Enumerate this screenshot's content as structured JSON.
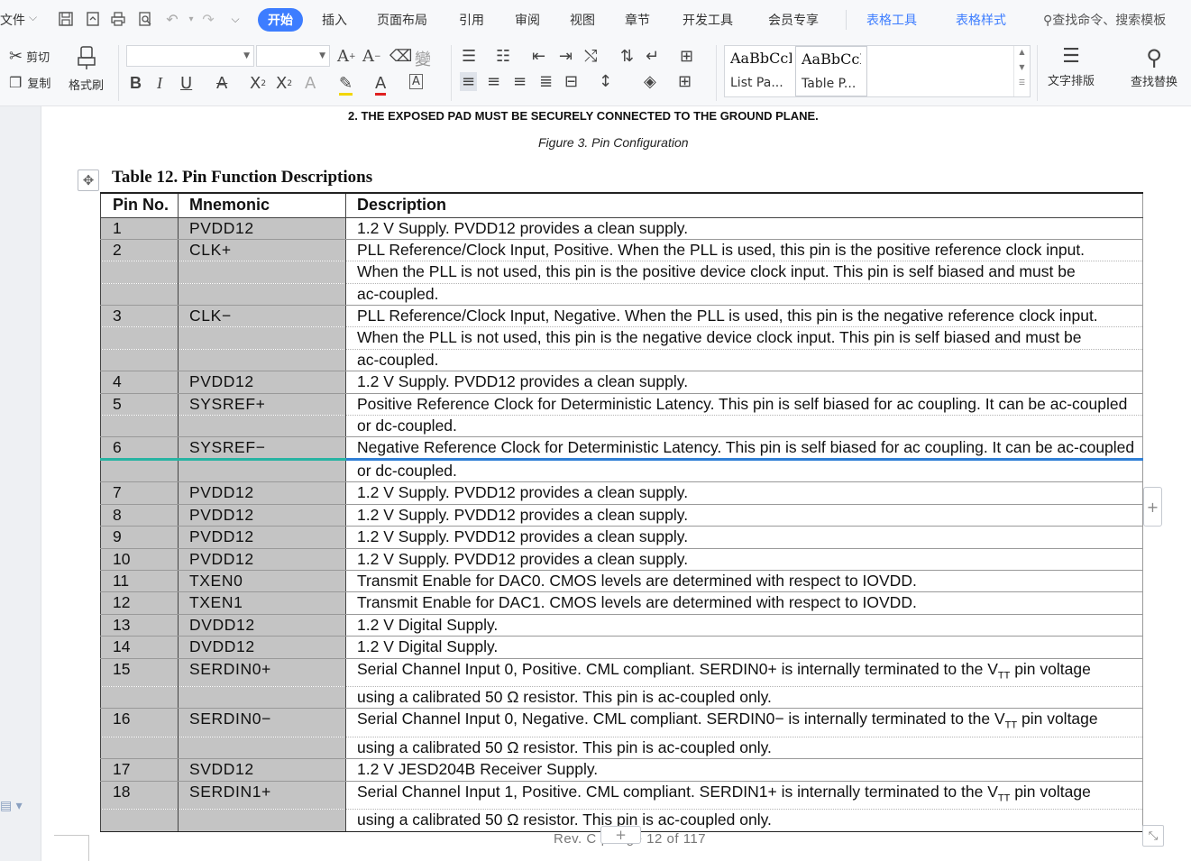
{
  "menubar": {
    "file_label": "文件",
    "tabs": [
      "开始",
      "插入",
      "页面布局",
      "引用",
      "审阅",
      "视图",
      "章节",
      "开发工具",
      "会员专享"
    ],
    "context_tabs": [
      "表格工具",
      "表格样式"
    ],
    "search_placeholder": "查找命令、搜索模板"
  },
  "ribbon": {
    "cut_label": "剪切",
    "copy_label": "复制",
    "format_painter_label": "格式刷",
    "styles": [
      {
        "sample": "AaBbCcI",
        "name": "List Pa..."
      },
      {
        "sample": "AaBbCcD",
        "name": "Table P..."
      }
    ],
    "text_layout_label": "文字排版",
    "find_replace_label": "查找替换"
  },
  "document": {
    "note": "2. THE EXPOSED PAD MUST BE SECURELY CONNECTED TO THE GROUND PLANE.",
    "figure_caption": "Figure 3. Pin Configuration",
    "table_title": "Table 12. Pin Function Descriptions",
    "headers": {
      "pin": "Pin No.",
      "mnemonic": "Mnemonic",
      "description": "Description"
    },
    "rows": [
      {
        "pin": "1",
        "mnemonic": "PVDD12",
        "lines": [
          "1.2 V Supply. PVDD12 provides a clean supply."
        ]
      },
      {
        "pin": "2",
        "mnemonic": "CLK+",
        "lines": [
          "PLL Reference/Clock Input, Positive. When the PLL is used, this pin is the positive reference clock input.",
          "When the PLL is not used, this pin is the positive device clock input. This pin is self biased and must be",
          "ac-coupled."
        ]
      },
      {
        "pin": "3",
        "mnemonic": "CLK−",
        "lines": [
          "PLL Reference/Clock Input, Negative. When the PLL is used, this pin is the negative reference clock input.",
          "When the PLL is not used, this pin is the negative device clock input. This pin is self biased and must be",
          "ac-coupled."
        ]
      },
      {
        "pin": "4",
        "mnemonic": "PVDD12",
        "lines": [
          "1.2 V Supply. PVDD12 provides a clean supply."
        ]
      },
      {
        "pin": "5",
        "mnemonic": "SYSREF+",
        "lines": [
          "Positive Reference Clock for Deterministic Latency. This pin is self biased for ac coupling. It can be ac-coupled",
          "or dc-coupled."
        ]
      },
      {
        "pin": "6",
        "mnemonic": "SYSREF−",
        "lines": [
          "Negative Reference Clock for Deterministic Latency. This pin is self biased for ac coupling. It can be ac-coupled",
          "or dc-coupled."
        ]
      },
      {
        "pin": "7",
        "mnemonic": "PVDD12",
        "lines": [
          "1.2 V Supply. PVDD12 provides a clean supply."
        ]
      },
      {
        "pin": "8",
        "mnemonic": "PVDD12",
        "lines": [
          "1.2 V Supply. PVDD12 provides a clean supply."
        ]
      },
      {
        "pin": "9",
        "mnemonic": "PVDD12",
        "lines": [
          "1.2 V Supply. PVDD12 provides a clean supply."
        ]
      },
      {
        "pin": "10",
        "mnemonic": "PVDD12",
        "lines": [
          "1.2 V Supply. PVDD12 provides a clean supply."
        ]
      },
      {
        "pin": "11",
        "mnemonic": "TXEN0",
        "lines": [
          "Transmit Enable for DAC0. CMOS levels are determined with respect to IOVDD."
        ]
      },
      {
        "pin": "12",
        "mnemonic": "TXEN1",
        "lines": [
          "Transmit Enable for DAC1. CMOS levels are determined with respect to IOVDD."
        ]
      },
      {
        "pin": "13",
        "mnemonic": "DVDD12",
        "lines": [
          "1.2 V Digital Supply."
        ]
      },
      {
        "pin": "14",
        "mnemonic": "DVDD12",
        "lines": [
          "1.2 V Digital Supply."
        ]
      },
      {
        "pin": "15",
        "mnemonic": "SERDIN0+",
        "lines": [
          "Serial Channel Input 0, Positive. CML compliant. SERDIN0+ is internally terminated to the V",
          "using a calibrated 50 Ω resistor. This pin is ac-coupled only."
        ],
        "vtt": {
          "sub": "TT",
          "after": " pin voltage"
        }
      },
      {
        "pin": "16",
        "mnemonic": "SERDIN0−",
        "lines": [
          "Serial Channel Input 0, Negative. CML compliant. SERDIN0− is internally terminated to the V",
          "using a calibrated 50 Ω resistor. This pin is ac-coupled only."
        ],
        "vtt": {
          "sub": "TT",
          "after": " pin voltage"
        }
      },
      {
        "pin": "17",
        "mnemonic": "SVDD12",
        "lines": [
          "1.2 V JESD204B Receiver Supply."
        ]
      },
      {
        "pin": "18",
        "mnemonic": "SERDIN1+",
        "lines": [
          "Serial Channel Input 1, Positive. CML compliant. SERDIN1+ is internally terminated to the V",
          "using a calibrated 50 Ω resistor. This pin is ac-coupled only."
        ],
        "vtt": {
          "sub": "TT",
          "after": " pin voltage"
        }
      }
    ],
    "footer": "Rev. C | Page 12 of 117",
    "add_row_symbol": "+",
    "add_col_symbol": "+"
  },
  "colors": {
    "accent": "#3d7dff",
    "cell_shade": "#c4c4c4",
    "row_select": "#2f7fd6",
    "row_select_left": "#27b3a2"
  }
}
